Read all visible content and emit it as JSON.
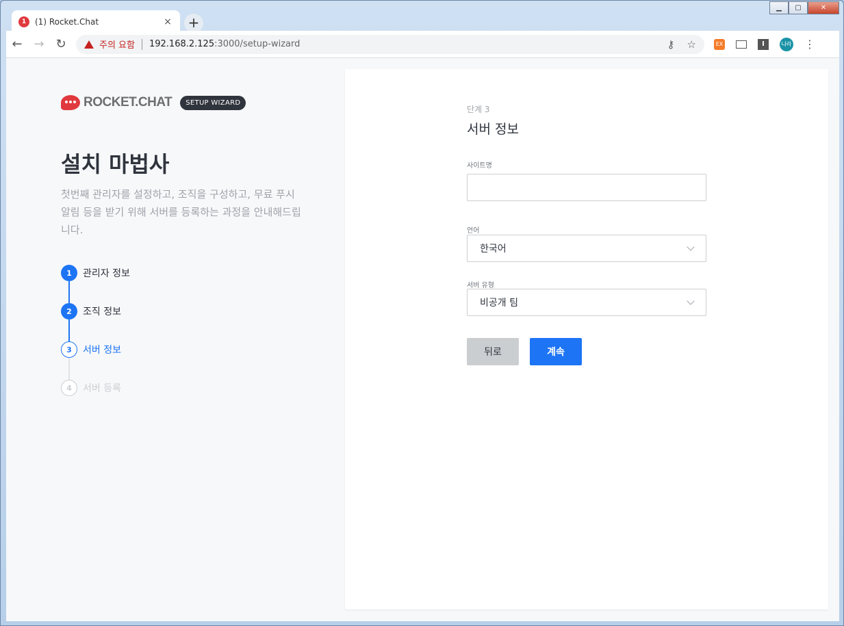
{
  "browser": {
    "tab_title": "(1) Rocket.Chat",
    "tab_close": "×",
    "new_tab": "+",
    "security_warning": "주의 요함",
    "url_host": "192.168.2.125",
    "url_path": ":3000/setup-wizard",
    "profile_initials": "나라",
    "window_controls": {
      "minimize": "▁",
      "maximize": "▢",
      "close": "✕"
    }
  },
  "sidebar": {
    "brand_name": "ROCKET.CHAT",
    "badge": "SETUP WIZARD",
    "heading": "설치 마법사",
    "description": "첫번째 관리자를 설정하고, 조직을 구성하고, 무료 푸시 알림 등을 받기 위해 서버를 등록하는 과정을 안내해드립니다.",
    "steps": [
      {
        "number": "1",
        "label": "관리자 정보",
        "state": "done"
      },
      {
        "number": "2",
        "label": "조직 정보",
        "state": "done"
      },
      {
        "number": "3",
        "label": "서버 정보",
        "state": "active"
      },
      {
        "number": "4",
        "label": "서버 등록",
        "state": "pending"
      }
    ]
  },
  "form": {
    "step_indicator": "단계 3",
    "title": "서버 정보",
    "site_name": {
      "label": "사이트명",
      "value": ""
    },
    "language": {
      "label": "언어",
      "value": "한국어"
    },
    "server_type": {
      "label": "서버 유형",
      "value": "비공개 팀"
    },
    "back_label": "뒤로",
    "continue_label": "계속"
  },
  "colors": {
    "accent": "#1d74f5",
    "brand_red": "#e0393e",
    "warning_red": "#c5221f"
  }
}
